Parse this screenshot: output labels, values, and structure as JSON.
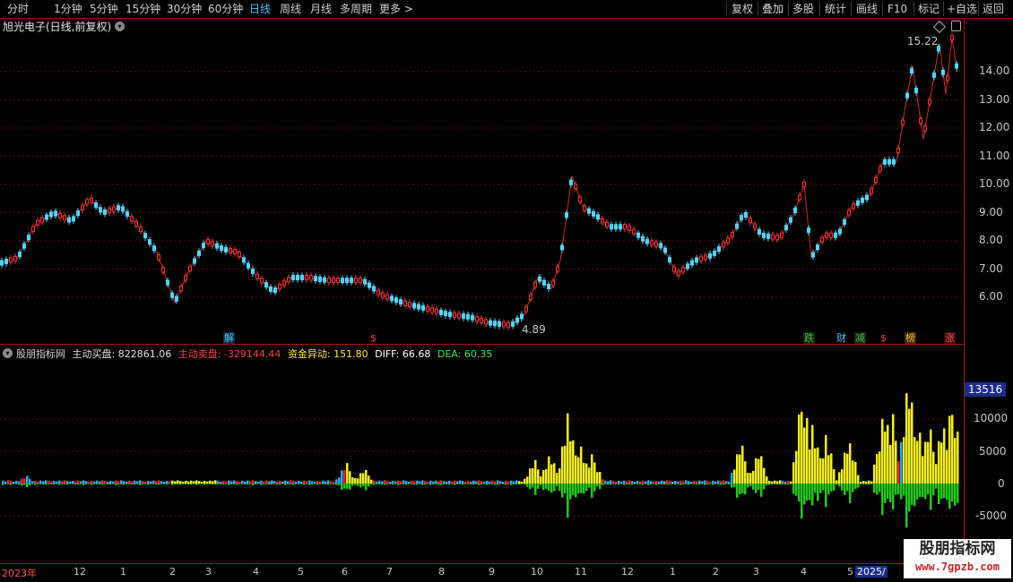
{
  "toolbar": {
    "left": [
      "分时",
      "1分钟",
      "5分钟",
      "15分钟",
      "30分钟",
      "60分钟",
      "日线",
      "周线",
      "月线",
      "多周期",
      "更多 >"
    ],
    "active": "日线",
    "right": [
      "复权",
      "叠加",
      "多股",
      "统计",
      "画线",
      "F10",
      "标记",
      "+自选",
      "返回"
    ]
  },
  "price_pane": {
    "title": "旭光电子(日线,前复权)",
    "high_label": "15.22",
    "low_label": "4.89",
    "y_ticks": [
      "14.00",
      "13.00",
      "12.00",
      "11.00",
      "10.00",
      "9.00",
      "8.00",
      "7.00",
      "6.00"
    ],
    "badges": [
      {
        "text": "解",
        "color": "#4fc3ff",
        "bg": "#0d2a3a"
      },
      {
        "text": "$",
        "color": "#ff3030",
        "bg": "#000000"
      },
      {
        "text": "跌",
        "color": "#4caf50",
        "bg": "#0d2a0d"
      },
      {
        "text": "财",
        "color": "#4fc3ff",
        "bg": "#000000"
      },
      {
        "text": "减",
        "color": "#4caf50",
        "bg": "#0d2a0d"
      },
      {
        "text": "$",
        "color": "#ff3030",
        "bg": "#000000"
      },
      {
        "text": "榜",
        "color": "#ffb74d",
        "bg": "#3a2a0a"
      },
      {
        "text": "涨",
        "color": "#ff5252",
        "bg": "#3a0d0d"
      }
    ],
    "up_color": "#ff3030",
    "down_color": "#4fd6ff"
  },
  "indicator": {
    "name": "股朋指标网",
    "buy_label": "主动买盘:",
    "buy_value": "822861.06",
    "sell_label": "主动卖盘:",
    "sell_value": "-329144.44",
    "flow_label": "资金异动:",
    "flow_value": "151.80",
    "diff_label": "DIFF:",
    "diff_value": "66.68",
    "dea_label": "DEA:",
    "dea_value": "60.35",
    "y_ticks": [
      "10000",
      "5000",
      "0",
      "-5000"
    ],
    "current_value": "13516"
  },
  "x_axis": [
    "2023年",
    "12",
    "1",
    "2",
    "3",
    "4",
    "5",
    "6",
    "7",
    "8",
    "9",
    "10",
    "11",
    "12",
    "1",
    "2",
    "3",
    "4",
    "5",
    "2025/"
  ],
  "watermark": {
    "line1": "股朋指标网",
    "line2": "www.7gpzb.com"
  }
}
